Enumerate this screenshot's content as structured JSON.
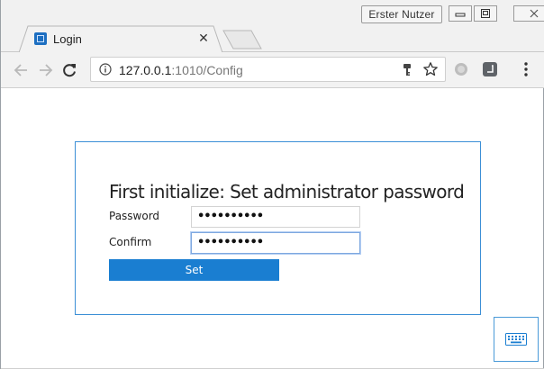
{
  "window": {
    "user_name": "Erster Nutzer",
    "icons": [
      "minimize-icon",
      "maximize-icon",
      "close-icon"
    ]
  },
  "tabs": [
    {
      "title": "Login",
      "active": true,
      "favicon": "app-favicon"
    }
  ],
  "toolbar": {
    "url_host": "127.0.0.1",
    "url_rest": ":1010/Config",
    "icons": [
      "back-icon",
      "forward-icon",
      "reload-icon",
      "info-icon",
      "key-icon",
      "star-icon",
      "extension-icon",
      "extension-icon",
      "menu-icon"
    ]
  },
  "form": {
    "title": "First initialize: Set administrator password",
    "password_label": "Password",
    "password_value": "••••••••••",
    "confirm_label": "Confirm",
    "confirm_value": "••••••••••",
    "set_label": "Set"
  },
  "colors": {
    "accent": "#1a7ed1",
    "card_border": "#3c8fd6"
  }
}
